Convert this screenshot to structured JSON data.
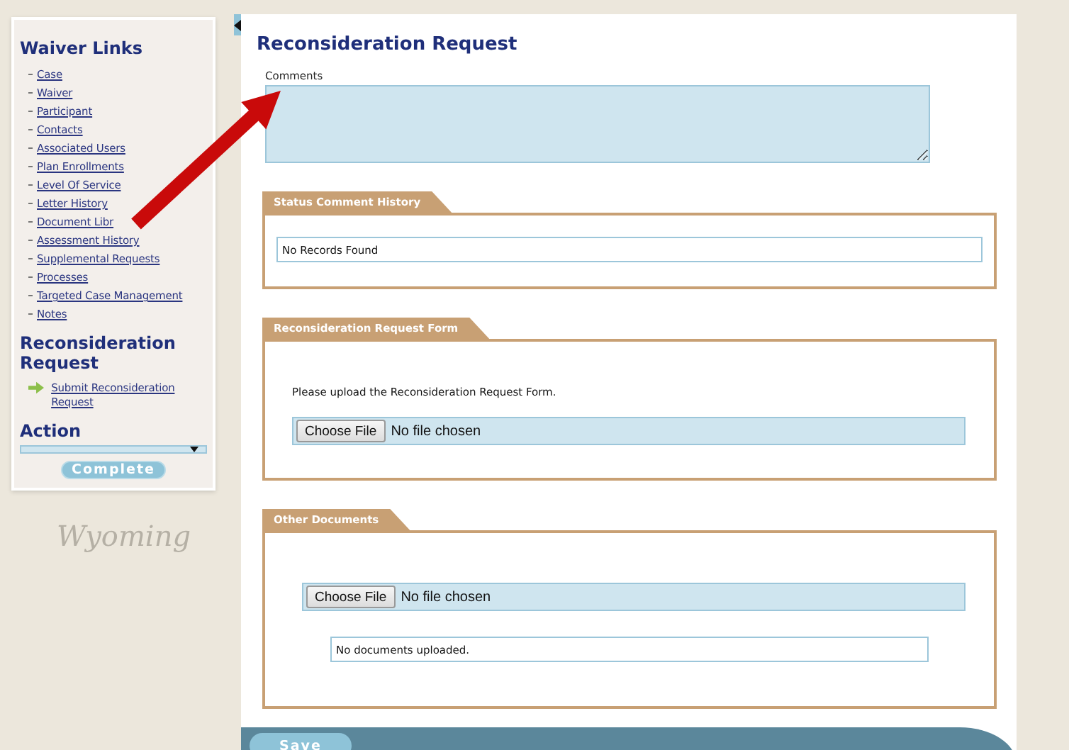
{
  "sidebar": {
    "title": "Waiver Links",
    "links": [
      "Case",
      "Waiver",
      "Participant",
      "Contacts",
      "Associated Users",
      "Plan Enrollments",
      "Level Of Service",
      "Letter History",
      "Document Libr",
      "Assessment History",
      "Supplemental Requests",
      "Processes",
      "Targeted Case Management",
      "Notes"
    ],
    "reconsideration": {
      "title": "Reconsideration Request",
      "link": "Submit Reconsideration Request"
    },
    "action": {
      "title": "Action"
    },
    "complete_button": "Complete"
  },
  "logo": "Wyoming",
  "main": {
    "title": "Reconsideration Request",
    "comments": {
      "label": "Comments"
    },
    "sections": [
      {
        "kind": "records",
        "title": "Status Comment History",
        "text": "No Records Found"
      },
      {
        "kind": "upload",
        "title": "Reconsideration Request Form",
        "instruction": "Please upload the Reconsideration Request Form.",
        "file": {
          "button": "Choose File",
          "status": "No file chosen"
        }
      },
      {
        "kind": "upload_list",
        "title": "Other Documents",
        "file": {
          "button": "Choose File",
          "status": "No file chosen"
        },
        "list_text": "No documents uploaded."
      }
    ]
  },
  "save_button": "Save"
}
